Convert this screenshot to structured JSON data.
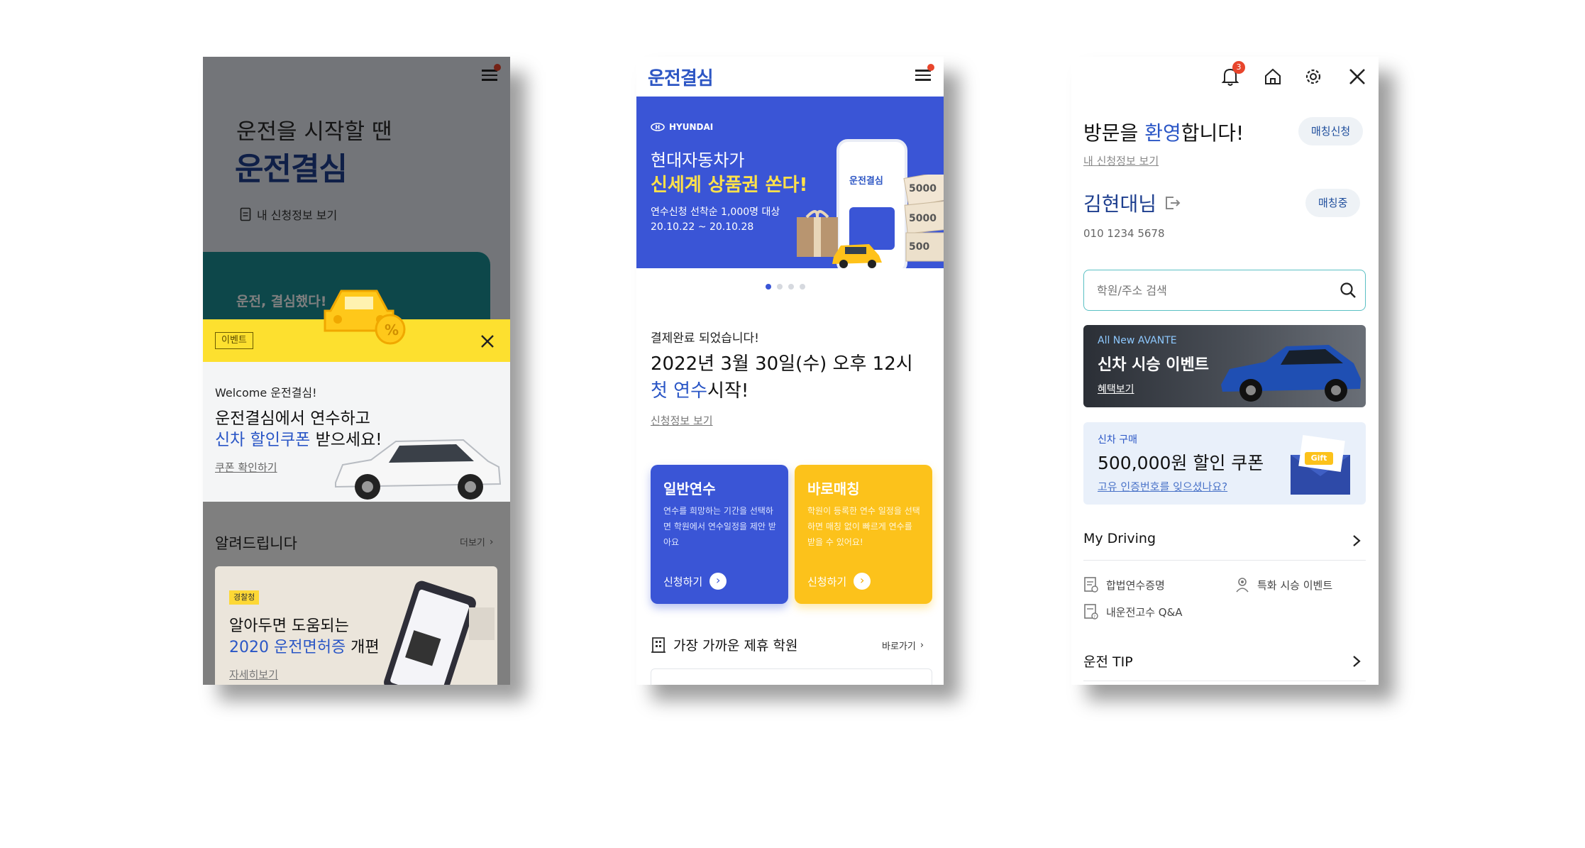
{
  "colors": {
    "navy": "#1e3f8f",
    "blue": "#3a55d6",
    "yellow": "#fcc21b",
    "event_yellow": "#fde02f",
    "teal": "#1a8f95",
    "badge_red": "#e8452c"
  },
  "screen1": {
    "hero_line1": "운전을 시작할 땐",
    "hero_title": "운전결심",
    "my_application_link": "내 신청정보 보기",
    "teal_card_text": "운전, 결심했다!",
    "event_badge": "이벤트",
    "welcome": "Welcome 운전결심!",
    "promo_line1": "운전결심에서 연수하고",
    "promo_line2_a": "신차 할인쿠폰",
    "promo_line2_b": " 받으세요!",
    "coupon_link": "쿠폰 확인하기",
    "notice_title": "알려드립니다",
    "more_link": "더보기",
    "news_badge": "경찰청",
    "news_line1": "알아두면 도움되는",
    "news_line2_a": "2020 운전면허증",
    "news_line2_b": " 개편",
    "news_link": "자세히보기"
  },
  "screen2": {
    "logo": "운전결심",
    "banner_brand": "HYUNDAI",
    "banner_line1": "현대자동차가",
    "banner_line2": "신세계 상품권 쏜다!",
    "banner_line3": "연수신청 선착순 1,000명 대상",
    "banner_line4": "20.10.22 ~ 20.10.28",
    "phone_mock_title": "운전결심",
    "payment_done": "결제완료 되었습니다!",
    "schedule_line1": "2022년 3월 30일(수) 오후 12시",
    "schedule_line2_a": "첫 연수",
    "schedule_line2_b": "시작!",
    "info_link": "신청정보 보기",
    "card1_title": "일반연수",
    "card1_desc": "연수를 희망하는 기간을 선택하면 학원에서 연수일정을 제안 받아요",
    "card1_cta": "신청하기",
    "card2_title": "바로매칭",
    "card2_desc": "학원이 등록한 연수 일정을 선택하면 매칭 없이 빠르게 연수를 받을 수 있어요!",
    "card2_cta": "신청하기",
    "nearby_title": "가장 가까운 제휴 학원",
    "nearby_link": "바로가기"
  },
  "screen3": {
    "notif_count": "3",
    "greeting_a": "방문을 ",
    "greeting_b": "환영",
    "greeting_c": "합니다!",
    "matching_apply_button": "매칭신청",
    "my_application_link": "내 신청정보 보기",
    "user_name": "김현대님",
    "matching_status_button": "매칭중",
    "phone_number": "010 1234 5678",
    "search_placeholder": "학원/주소 검색",
    "banner_tag": "All New AVANTE",
    "banner_title": "신차 시승 이벤트",
    "banner_link": "혜택보기",
    "coupon_tag": "신차 구매",
    "coupon_title": "500,000원 할인 쿠폰",
    "coupon_link": "고유 인증번호를 잊으셨나요?",
    "gift_label": "Gift",
    "section1": "My Driving",
    "menu1": "합법연수증명",
    "menu2": "특화 시승 이벤트",
    "menu3": "내운전고수 Q&A",
    "section2": "운전 TIP"
  }
}
